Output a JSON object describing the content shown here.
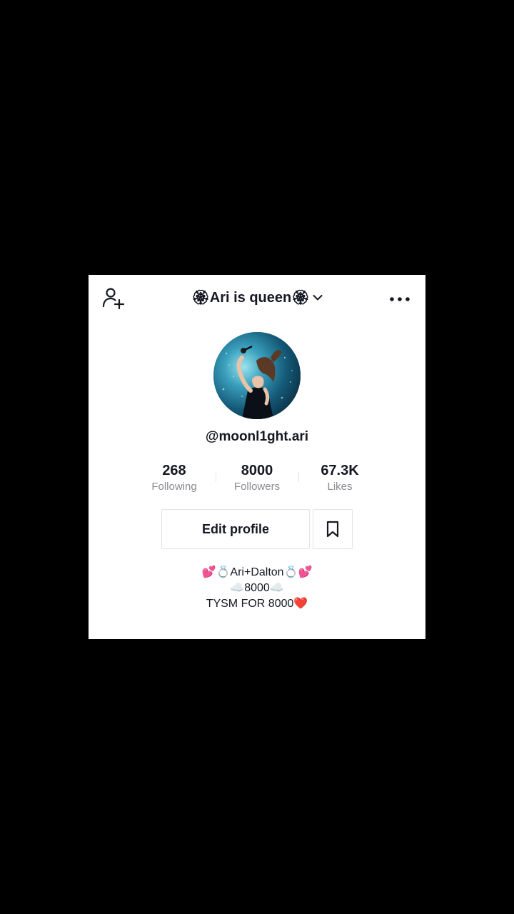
{
  "header": {
    "title": "🏵Ari is queen🏵",
    "add_user_icon": "add-user-icon",
    "dropdown_icon": "chevron-down-icon",
    "more_icon": "more-horizontal-icon"
  },
  "profile": {
    "handle": "@moonl1ght.ari",
    "avatar": "singer-photo"
  },
  "stats": {
    "following": {
      "value": "268",
      "label": "Following"
    },
    "followers": {
      "value": "8000",
      "label": "Followers"
    },
    "likes": {
      "value": "67.3K",
      "label": "Likes"
    }
  },
  "actions": {
    "edit_profile_label": "Edit profile",
    "bookmark_icon": "bookmark-icon"
  },
  "bio": {
    "lines": [
      "💕💍Ari+Dalton💍💕",
      "☁️8000☁️",
      "TYSM FOR 8000❤️"
    ]
  },
  "colors": {
    "background": "#000000",
    "card": "#ffffff",
    "text_primary": "#161823",
    "text_secondary": "#8a8b91",
    "border": "#e3e3e4"
  }
}
